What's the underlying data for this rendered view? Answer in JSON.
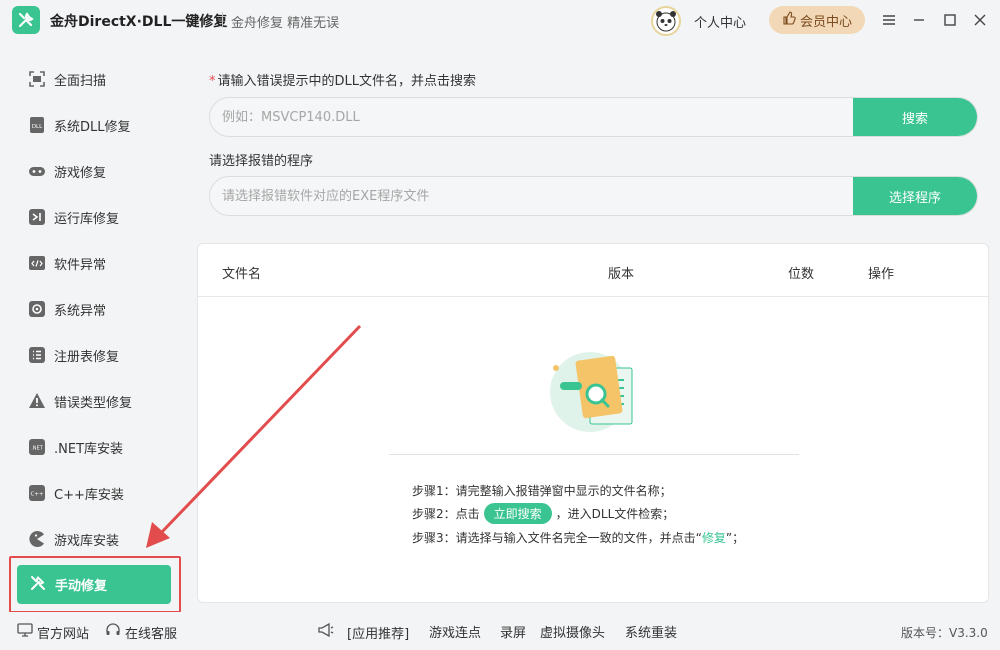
{
  "titlebar": {
    "app_title": "金舟DirectX·DLL一键修复",
    "slogan": "金舟修复 精准无误",
    "user_center": "个人中心",
    "vip_button": "会员中心"
  },
  "sidebar": {
    "items": [
      {
        "label": "全面扫描",
        "icon": "scan-icon"
      },
      {
        "label": "系统DLL修复",
        "icon": "dll-icon"
      },
      {
        "label": "游戏修复",
        "icon": "gamepad-icon"
      },
      {
        "label": "运行库修复",
        "icon": "vs-icon"
      },
      {
        "label": "软件异常",
        "icon": "code-icon"
      },
      {
        "label": "系统异常",
        "icon": "gear-icon"
      },
      {
        "label": "注册表修复",
        "icon": "list-icon"
      },
      {
        "label": "错误类型修复",
        "icon": "warning-icon"
      },
      {
        "label": ".NET库安装",
        "icon": "dotnet-icon"
      },
      {
        "label": "C++库安装",
        "icon": "cpp-icon"
      },
      {
        "label": "游戏库安装",
        "icon": "pacman-icon"
      }
    ],
    "active_item": {
      "label": "手动修复",
      "icon": "tools-icon"
    }
  },
  "main": {
    "dll_label": "请输入错误提示中的DLL文件名，并点击搜索",
    "dll_placeholder": "例如：MSVCP140.DLL",
    "search_button": "搜索",
    "program_label": "请选择报错的程序",
    "program_placeholder": "请选择报错软件对应的EXE程序文件",
    "select_button": "选择程序",
    "table": {
      "headers": [
        "文件名",
        "版本",
        "位数",
        "操作"
      ]
    },
    "steps": {
      "step1": "步骤1：请完整输入报错弹窗中显示的文件名称；",
      "step2_prefix": "步骤2：点击",
      "step2_button": "立即搜索",
      "step2_suffix": "，进入DLL文件检索；",
      "step3_prefix": "步骤3：请选择与输入文件名完全一致的文件，并点击“",
      "step3_highlight": "修复",
      "step3_suffix": "”；"
    }
  },
  "footer": {
    "official_site": "官方网站",
    "online_service": "在线客服",
    "recommend": "[应用推荐]",
    "links": [
      "游戏连点",
      "录屏",
      "虚拟摄像头",
      "系统重装"
    ],
    "version": "版本号：V3.3.0"
  },
  "colors": {
    "accent": "#39c492",
    "highlight_border": "#e34c4c",
    "vip_bg": "#f2d8b6"
  }
}
